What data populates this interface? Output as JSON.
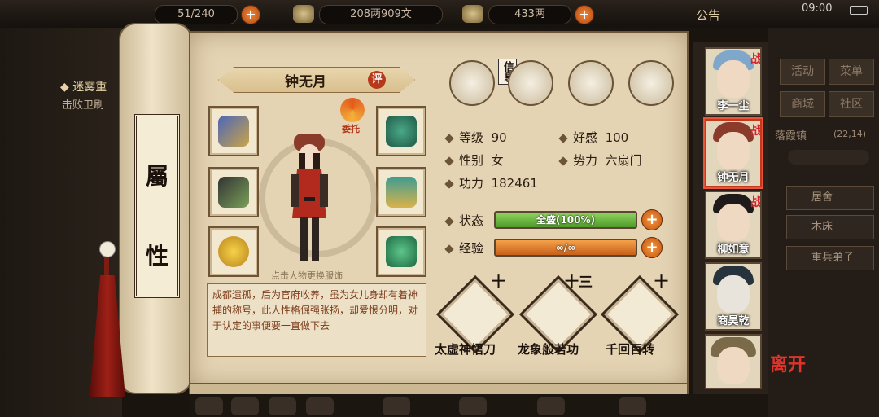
{
  "topbar": {
    "stamina": "51/240",
    "silver": "208两909文",
    "gold": "433两",
    "notice": "公告",
    "clock": "09:00"
  },
  "quest": {
    "title": "◆ 迷雾重",
    "desc": "击败卫刷"
  },
  "scroll": {
    "chars": [
      "屬",
      "性"
    ]
  },
  "character": {
    "name": "钟无月",
    "rate_badge": "评",
    "swap_label": "委托",
    "change_hint": "点击人物更换服饰",
    "bio": "成都遗孤，后为官府收养，虽为女儿身却有着神捕的称号，此人性格倔强张扬，却爱恨分明，对于认定的事便要一直做下去"
  },
  "tabs": {
    "info_label": "信息"
  },
  "stats": {
    "level_label": "等级",
    "level": "90",
    "favor_label": "好感",
    "favor": "100",
    "gender_label": "性别",
    "gender": "女",
    "faction_label": "势力",
    "faction": "六扇门",
    "power_label": "功力",
    "power": "182461",
    "status_label": "状态",
    "status_value": "全盛(100%)",
    "status_fill": 1.0,
    "exp_label": "经验",
    "exp_value": "∞/∞",
    "exp_fill": 1.0
  },
  "skills": [
    {
      "name": "太虚神悟刀",
      "level": "十"
    },
    {
      "name": "龙象般若功",
      "level": "十三"
    },
    {
      "name": "千回百转",
      "level": "十"
    }
  ],
  "roster": [
    {
      "name": "李一尘"
    },
    {
      "name": "钟无月"
    },
    {
      "name": "柳如意"
    },
    {
      "name": "商昊乾"
    },
    {
      "name": ""
    }
  ],
  "roster_mark": "战",
  "right_menu": {
    "activity": "活动",
    "menu": "菜单",
    "shop": "商城",
    "community": "社区",
    "location": "落霞镇",
    "coords": "(22,14)",
    "residence": "居舍",
    "bed": "木床",
    "disciple": "重兵弟子",
    "leave": "离开"
  },
  "colors": {
    "accent": "#b6391c",
    "status": "#6bbf3f",
    "exp": "#e07a2a",
    "selected": "#e8553a"
  }
}
